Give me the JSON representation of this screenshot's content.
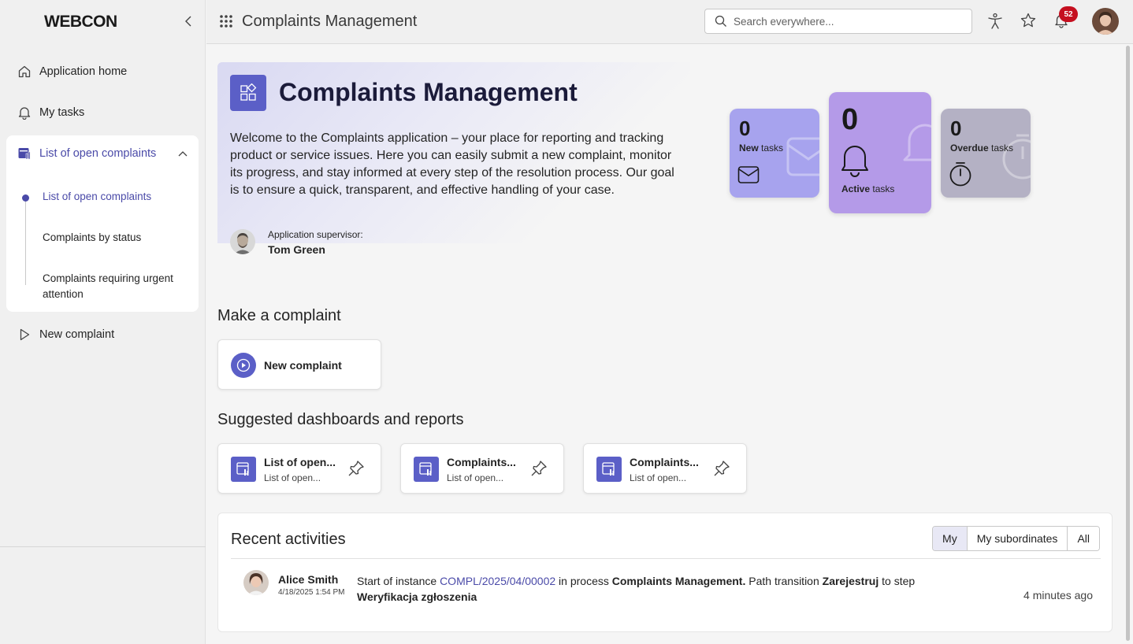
{
  "brand": {
    "logo": "WEBCON",
    "accent": "#5b5fc7"
  },
  "sidebar": {
    "items": [
      {
        "label": "Application home",
        "icon": "home-icon"
      },
      {
        "label": "My tasks",
        "icon": "bell-icon"
      }
    ],
    "group": {
      "label": "List of open complaints",
      "icon": "report-icon",
      "expanded": true,
      "children": [
        {
          "label": "List of open complaints",
          "active": true
        },
        {
          "label": "Complaints by status",
          "active": false
        },
        {
          "label": "Complaints requiring urgent attention",
          "active": false
        }
      ]
    },
    "after_items": [
      {
        "label": "New complaint",
        "icon": "play-icon"
      }
    ]
  },
  "topbar": {
    "title": "Complaints Management",
    "search_placeholder": "Search everywhere...",
    "notifications_count": "52"
  },
  "hero": {
    "title": "Complaints Management",
    "description": "Welcome to the Complaints application – your place for reporting and tracking product or service issues. Here you can easily submit a new complaint, monitor its progress, and stay informed at every step of the resolution process. Our goal is to ensure a quick, transparent, and effective handling of your case.",
    "supervisor_label": "Application supervisor:",
    "supervisor_name": "Tom Green"
  },
  "tiles": [
    {
      "count": "0",
      "strong": "New",
      "label": " tasks",
      "color": "#a7a3ee",
      "icon": "mail-icon"
    },
    {
      "count": "0",
      "strong": "Active",
      "label": " tasks",
      "color": "#b49ae8",
      "icon": "bell-icon"
    },
    {
      "count": "0",
      "strong": "Overdue",
      "label": " tasks",
      "color": "#b4b1c4",
      "icon": "timer-icon"
    }
  ],
  "make_complaint": {
    "heading": "Make a complaint",
    "button_label": "New complaint"
  },
  "dashboards": {
    "heading": "Suggested dashboards and reports",
    "items": [
      {
        "title": "List of open...",
        "subtitle": "List of open..."
      },
      {
        "title": "Complaints...",
        "subtitle": "List of open..."
      },
      {
        "title": "Complaints...",
        "subtitle": "List of open..."
      }
    ]
  },
  "activities": {
    "heading": "Recent activities",
    "filters": [
      "My",
      "My subordinates",
      "All"
    ],
    "selected_filter": "My",
    "entries": [
      {
        "user": "Alice Smith",
        "date": "4/18/2025 1:54 PM",
        "text_1": "Start of instance ",
        "instance": "COMPL/2025/04/00002",
        "text_2": " in process ",
        "process": "Complaints Management.",
        "text_3": " Path transition ",
        "transition": "Zarejestruj",
        "text_4": " to step ",
        "step": "Weryfikacja zgłoszenia",
        "time_ago": "4 minutes ago"
      }
    ]
  }
}
